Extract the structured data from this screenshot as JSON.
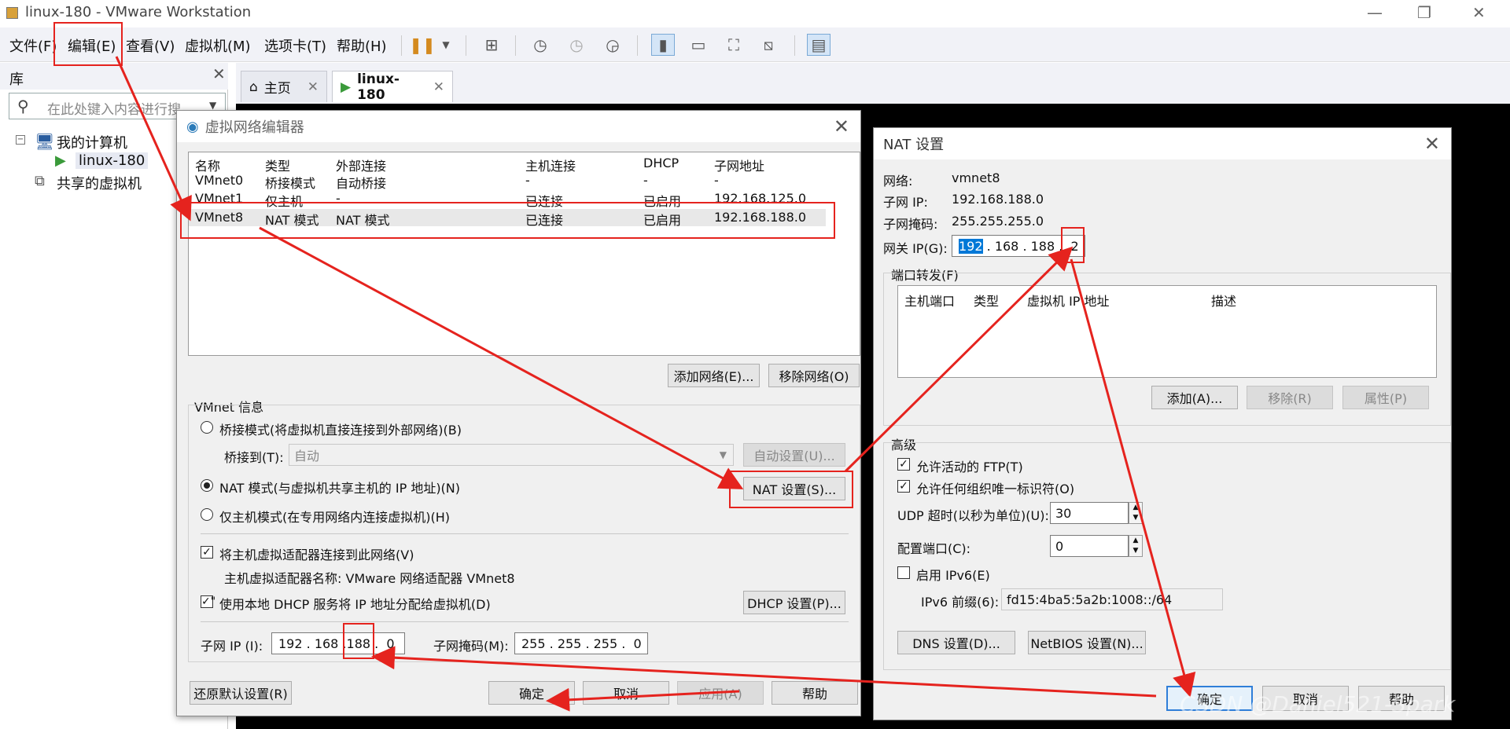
{
  "window": {
    "title": "linux-180 - VMware Workstation"
  },
  "menu": [
    "文件(F)",
    "编辑(E)",
    "查看(V)",
    "虚拟机(M)",
    "选项卡(T)",
    "帮助(H)"
  ],
  "library": {
    "title": "库",
    "search_placeholder": "在此处键入内容进行搜",
    "tree": {
      "my_computer": "我的计算机",
      "vm": "linux-180",
      "shared": "共享的虚拟机"
    }
  },
  "tabs": [
    {
      "label": "主页"
    },
    {
      "label": "linux-180"
    }
  ],
  "vne": {
    "title": "虚拟网络编辑器",
    "columns": [
      "名称",
      "类型",
      "外部连接",
      "主机连接",
      "DHCP",
      "子网地址"
    ],
    "rows": [
      [
        "VMnet0",
        "桥接模式",
        "自动桥接",
        "-",
        "-",
        "-"
      ],
      [
        "VMnet1",
        "仅主机",
        "-",
        "已连接",
        "已启用",
        "192.168.125.0"
      ],
      [
        "VMnet8",
        "NAT 模式",
        "NAT 模式",
        "已连接",
        "已启用",
        "192.168.188.0"
      ]
    ],
    "add_network": "添加网络(E)...",
    "remove_network": "移除网络(O)",
    "info_title": "VMnet 信息",
    "bridge_radio": "桥接模式(将虚拟机直接连接到外部网络)(B)",
    "bridge_to_label": "桥接到(T):",
    "bridge_to_value": "自动",
    "auto_settings": "自动设置(U)...",
    "nat_radio": "NAT 模式(与虚拟机共享主机的 IP 地址)(N)",
    "nat_settings": "NAT 设置(S)...",
    "hostonly_radio": "仅主机模式(在专用网络内连接虚拟机)(H)",
    "connect_adapter": "将主机虚拟适配器连接到此网络(V)",
    "adapter_name": "主机虚拟适配器名称: VMware 网络适配器 VMnet8",
    "use_dhcp": "使用本地 DHCP 服务将 IP 地址分配给虚拟机(D)",
    "dhcp_settings": "DHCP 设置(P)...",
    "subnet_ip_label": "子网 IP (I):",
    "subnet_ip": [
      "192",
      "168",
      "188",
      "0"
    ],
    "subnet_mask_label": "子网掩码(M):",
    "subnet_mask": [
      "255",
      "255",
      "255",
      "0"
    ],
    "restore_defaults": "还原默认设置(R)",
    "ok": "确定",
    "cancel": "取消",
    "apply": "应用(A)",
    "help": "帮助"
  },
  "nat": {
    "title": "NAT 设置",
    "network_label": "网络:",
    "network": "vmnet8",
    "subnet_ip_label": "子网 IP:",
    "subnet_ip": "192.168.188.0",
    "subnet_mask_label": "子网掩码:",
    "subnet_mask": "255.255.255.0",
    "gateway_label": "网关 IP(G):",
    "gateway": [
      "192",
      "168",
      "188",
      "2"
    ],
    "port_forward": "端口转发(F)",
    "pf_columns": [
      "主机端口",
      "类型",
      "虚拟机 IP 地址",
      "描述"
    ],
    "add": "添加(A)...",
    "remove": "移除(R)",
    "properties": "属性(P)",
    "advanced": "高级",
    "allow_ftp": "允许活动的 FTP(T)",
    "allow_oui": "允许任何组织唯一标识符(O)",
    "udp_label": "UDP 超时(以秒为单位)(U):",
    "udp_value": "30",
    "config_port_label": "配置端口(C):",
    "config_port_value": "0",
    "enable_ipv6": "启用 IPv6(E)",
    "ipv6_label": "IPv6 前缀(6):",
    "ipv6_value": "fd15:4ba5:5a2b:1008::/64",
    "dns": "DNS 设置(D)...",
    "netbios": "NetBIOS 设置(N)...",
    "ok": "确定",
    "cancel": "取消",
    "help": "帮助"
  },
  "watermark": "CSDN @Daniel521-Spark"
}
